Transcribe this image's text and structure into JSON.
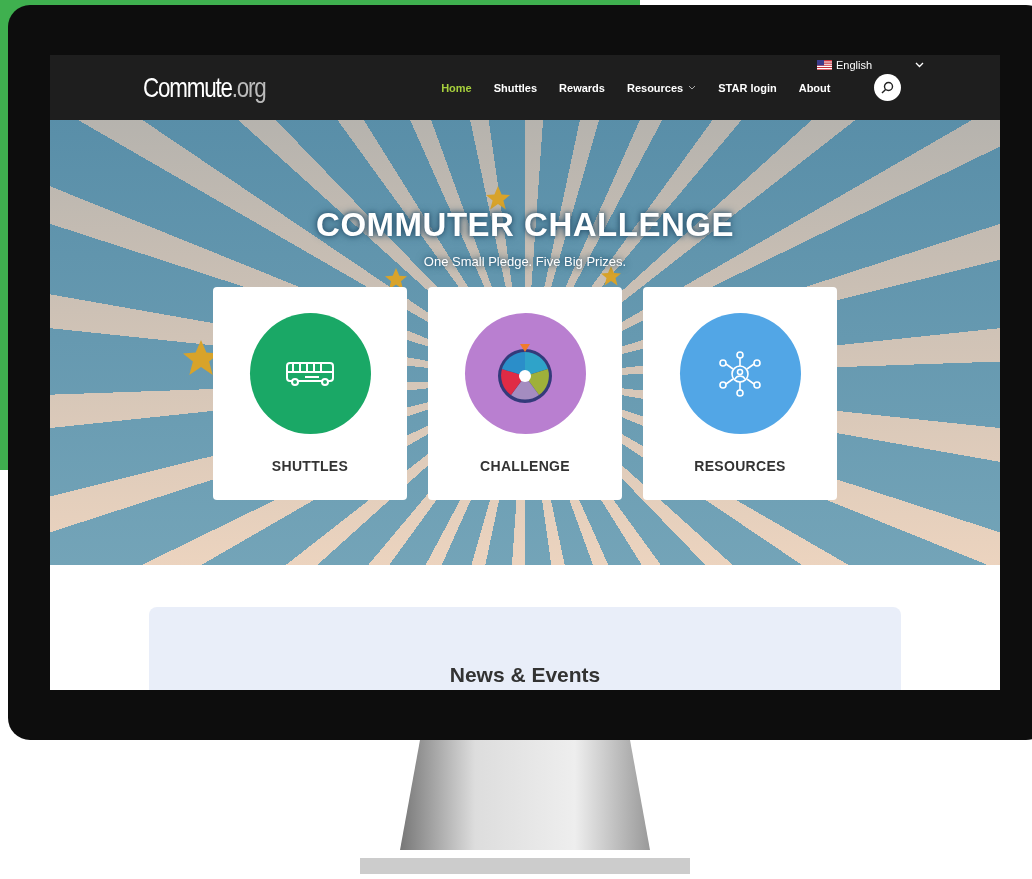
{
  "language": {
    "label": "English"
  },
  "header": {
    "logo": "**Commute**.org",
    "nav": [
      {
        "label": "Home",
        "selected": true,
        "has_menu": false
      },
      {
        "label": "Shuttles",
        "selected": false,
        "has_menu": false
      },
      {
        "label": "Rewards",
        "selected": false,
        "has_menu": false
      },
      {
        "label": "Resources",
        "selected": false,
        "has_menu": true
      },
      {
        "label": "STAR login",
        "selected": false,
        "has_menu": false
      },
      {
        "label": "About",
        "selected": false,
        "has_menu": false
      }
    ]
  },
  "hero": {
    "title": "COMMUTER CHALLENGE",
    "subtitle": "One Small Pledge. Five Big Prizes.",
    "cards": [
      {
        "label": "SHUTTLES",
        "kind": "bus",
        "color": "#1aa866"
      },
      {
        "label": "CHALLENGE",
        "kind": "wheel",
        "color": "#b97fd0"
      },
      {
        "label": "RESOURCES",
        "kind": "network",
        "color": "#52a6e6"
      }
    ]
  },
  "news": {
    "heading": "News & Events"
  }
}
